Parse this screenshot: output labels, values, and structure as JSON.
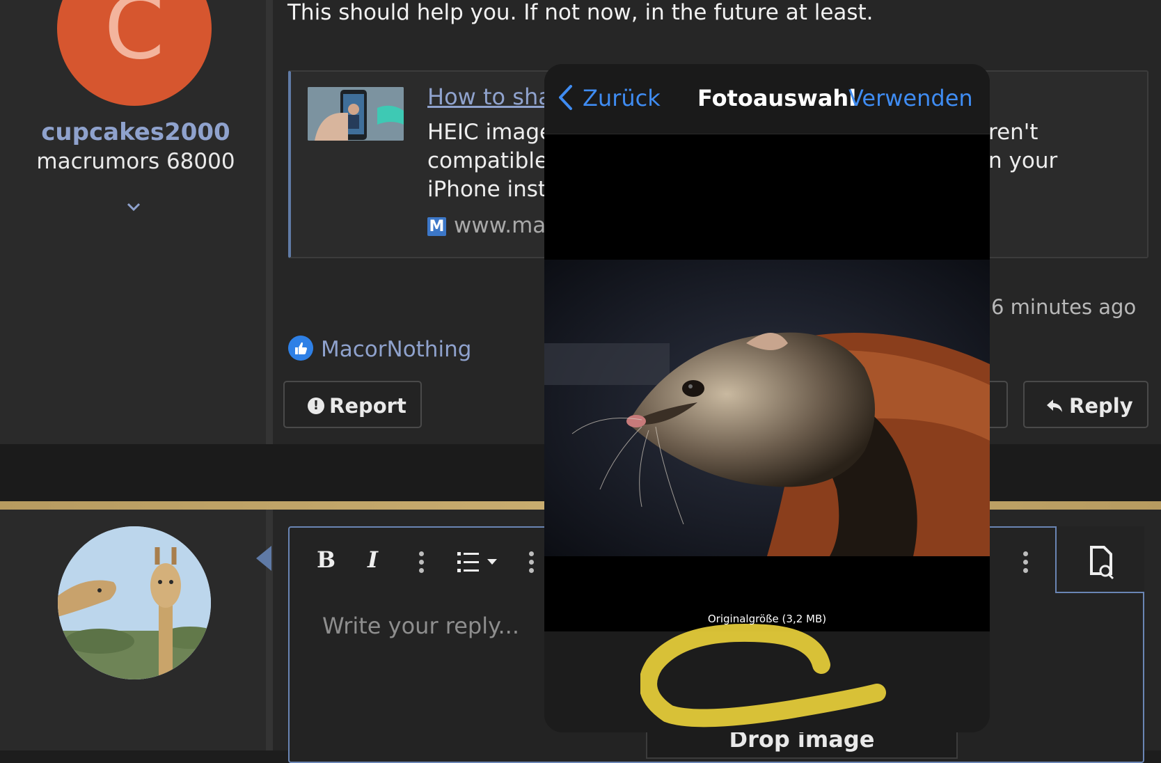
{
  "post": {
    "username": "cupcakes2000",
    "user_title": "macrumors 68000",
    "avatar_letter": "C",
    "text": "This should help you. If not now, in the future at least.",
    "link_card": {
      "title_partial": "How to sha",
      "description_lines": [
        "HEIC image",
        "compatible",
        "iPhone inst"
      ],
      "description_right": [
        "ren't",
        "n your"
      ],
      "favicon_letter": "M",
      "domain_partial": "www.ma"
    },
    "timestamp": "6 minutes ago",
    "liked_by": "MacorNothing",
    "actions": {
      "report": "Report",
      "reply": "Reply"
    }
  },
  "reply_editor": {
    "placeholder": "Write your reply...",
    "toolbar": {
      "bold": "B",
      "italic": "I"
    },
    "drop_image_label": "Drop image"
  },
  "photo_picker": {
    "back_label": "Zurück",
    "title": "Fotoauswahl",
    "use_label": "Verwenden",
    "size_option": "Originalgröße (3,2 MB)"
  },
  "colors": {
    "accent": "#3f8cf2",
    "username": "#8fa2cd",
    "avatar": "#d6562f",
    "gold_bar": "#c9ad70",
    "highlight": "#e8cf3a"
  },
  "icons": [
    "chevron-down-icon",
    "thumbs-up-icon",
    "exclamation-icon",
    "reply-arrow-icon",
    "list-icon",
    "preview-search-icon",
    "back-chevron-icon"
  ]
}
